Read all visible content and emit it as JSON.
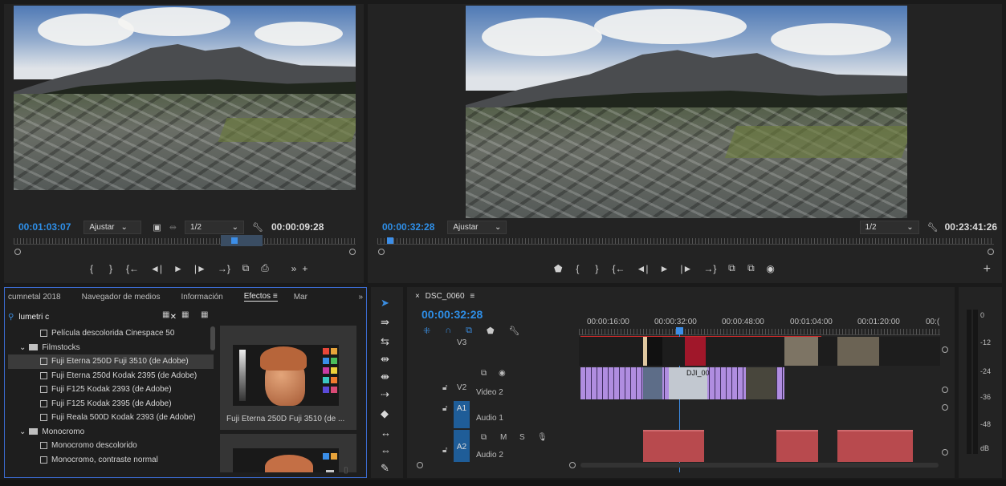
{
  "source": {
    "timecode": "00:01:03:07",
    "fit": "Ajustar",
    "resolution": "1/2",
    "duration": "00:00:09:28",
    "controls": [
      "{",
      "}",
      "{←",
      "◄|",
      "►",
      "|►",
      "→}",
      "⧉",
      "⎙",
      "»",
      "+"
    ]
  },
  "program": {
    "timecode": "00:00:32:28",
    "fit": "Ajustar",
    "resolution": "1/2",
    "duration": "00:23:41:26",
    "controls": [
      "⬟",
      "{",
      "}",
      "{←",
      "◄|",
      "►",
      "|►",
      "→}",
      "⧉",
      "⧉",
      "◉",
      "+"
    ]
  },
  "effects_panel": {
    "tabs": [
      "cumnetal 2018",
      "Navegador de medios",
      "Información",
      "Efectos",
      "Mar"
    ],
    "active_tab": "Efectos",
    "search_value": "lumetri c",
    "tree": [
      {
        "label": "Película descolorida Cinespace 50",
        "kind": "fx",
        "indent": 2
      },
      {
        "label": "Filmstocks",
        "kind": "folder",
        "indent": 1
      },
      {
        "label": "Fuji Eterna 250D Fuji 3510 (de Adobe)",
        "kind": "fx",
        "indent": 2,
        "selected": true
      },
      {
        "label": "Fuji Eterna 250d Kodak 2395 (de Adobe)",
        "kind": "fx",
        "indent": 2
      },
      {
        "label": "Fuji F125 Kodak 2393 (de Adobe)",
        "kind": "fx",
        "indent": 2
      },
      {
        "label": "Fuji F125 Kodak 2395 (de Adobe)",
        "kind": "fx",
        "indent": 2
      },
      {
        "label": "Fuji Reala 500D Kodak 2393 (de Adobe)",
        "kind": "fx",
        "indent": 2
      },
      {
        "label": "Monocromo",
        "kind": "folder",
        "indent": 1
      },
      {
        "label": "Monocromo descolorido",
        "kind": "fx",
        "indent": 2
      },
      {
        "label": "Monocromo, contraste normal",
        "kind": "fx",
        "indent": 2
      }
    ],
    "preview_caption": "Fuji Eterna 250D Fuji 3510 (de ..."
  },
  "timeline": {
    "sequence_name": "DSC_0060",
    "timecode": "00:00:32:28",
    "ruler_labels": [
      "00:00:16:00",
      "00:00:32:00",
      "00:00:48:00",
      "00:01:04:00",
      "00:01:20:00",
      "00:("
    ],
    "tracks": [
      {
        "id": "V3",
        "name": ""
      },
      {
        "id": "V2",
        "name": "Video 2"
      },
      {
        "id": "A1",
        "name": "Audio 1"
      },
      {
        "id": "A2",
        "name": "Audio 2"
      }
    ],
    "clip_label": "DJI_00"
  },
  "meter": {
    "scale": [
      "0",
      "-12",
      "-24",
      "-36",
      "-48",
      "dB"
    ]
  },
  "colors": {
    "accent_blue": "#2e8fe8",
    "video_clip": "#b08de0",
    "audio_clip": "#b84a4e",
    "selection_border": "#3b6bd0"
  }
}
